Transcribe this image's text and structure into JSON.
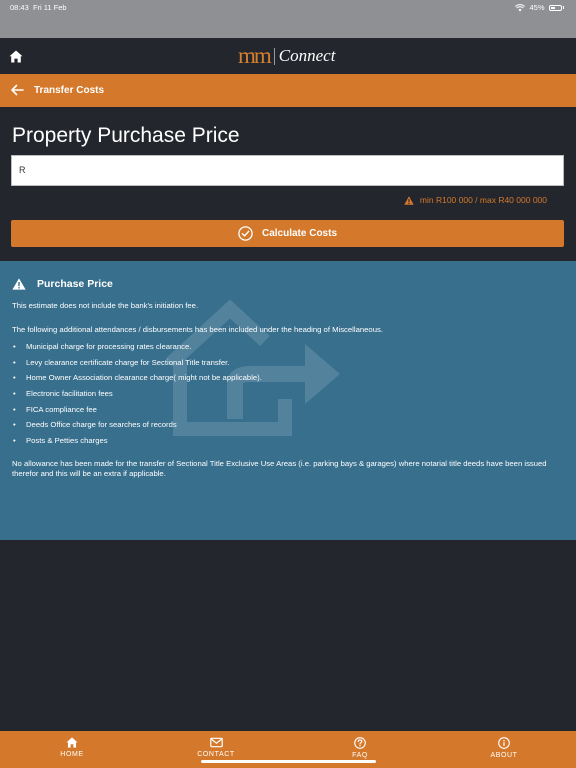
{
  "status_bar": {
    "time": "08:43",
    "date": "Fri 11 Feb",
    "battery": "45%",
    "battery_level": 0.45
  },
  "header": {
    "logo_mark": "mm",
    "logo_text": "Connect",
    "home_icon": "home-icon"
  },
  "nav": {
    "back_icon": "arrow-left-icon",
    "title": "Transfer Costs"
  },
  "form": {
    "heading": "Property Purchase Price",
    "input_value": "R",
    "hint": "min R100 000 / max R40 000 000",
    "calculate_label": "Calculate Costs"
  },
  "info": {
    "title": "Purchase Price",
    "note": "This estimate does not include the bank's initiation fee.",
    "intro": "The following additional attendances / disbursements has been included under the heading of Miscellaneous.",
    "items": [
      "Municipal charge for processing rates clearance.",
      "Levy clearance certificate charge for Sectional Title transfer.",
      "Home Owner Association clearance charge( might not be applicable).",
      "Electronic facilitation fees",
      "FICA compliance fee",
      "Deeds Office charge for searches of records",
      "Posts & Petties charges"
    ],
    "footer": "No allowance has been made for the transfer of Sectional Title Exclusive Use Areas (i.e. parking bays & garages) where notarial title deeds have been issued therefor and this will be an extra if applicable."
  },
  "tabs": [
    {
      "label": "HOME",
      "icon": "home-icon"
    },
    {
      "label": "CONTACT",
      "icon": "mail-icon"
    },
    {
      "label": "FAQ",
      "icon": "question-icon"
    },
    {
      "label": "ABOUT",
      "icon": "info-icon"
    }
  ],
  "colors": {
    "accent": "#d4792c",
    "background": "#23262d",
    "info_panel": "#386f8d",
    "status_bar": "#8f9094"
  }
}
